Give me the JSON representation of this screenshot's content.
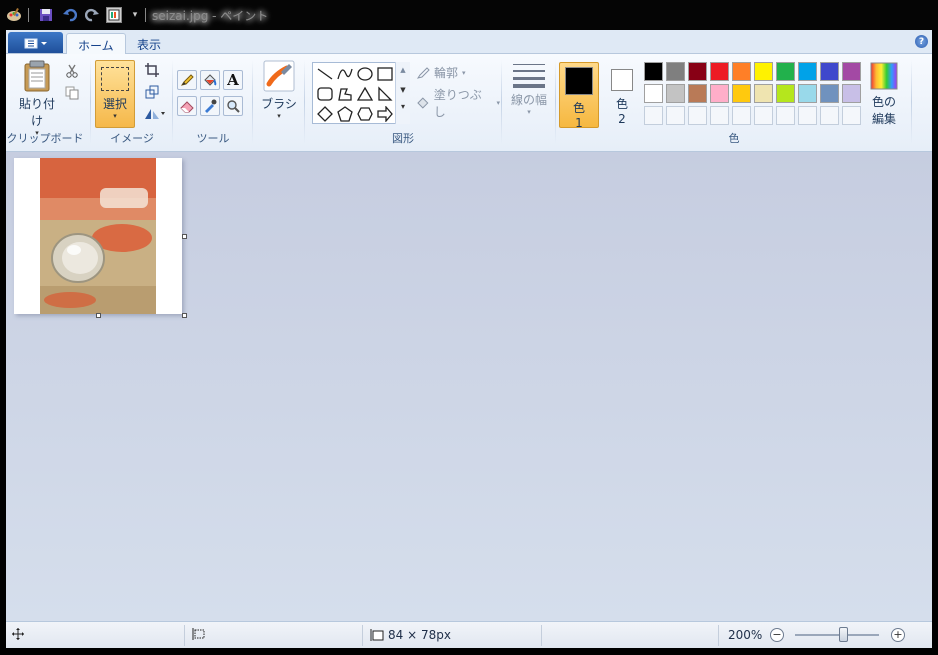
{
  "window": {
    "title": "seizai.jpg - ペイント",
    "quick_access": [
      "paint-app-icon",
      "save-icon",
      "undo-icon",
      "redo-icon",
      "properties-icon",
      "customize-dropdown-icon"
    ]
  },
  "ribbon": {
    "tabs": [
      {
        "label": "ホーム",
        "active": true
      },
      {
        "label": "表示",
        "active": false
      }
    ],
    "groups": {
      "clipboard": {
        "label": "クリップボード",
        "paste_label": "貼り付け"
      },
      "image": {
        "label": "イメージ",
        "select_label": "選択"
      },
      "tools": {
        "label": "ツール"
      },
      "brush": {
        "label": "ブラシ"
      },
      "shapes": {
        "label": "図形",
        "outline_label": "輪郭",
        "fill_label": "塗りつぶし"
      },
      "size": {
        "label": "線の幅"
      },
      "colors": {
        "label": "色",
        "color1_label": "色",
        "color1_num": "1",
        "color2_label": "色",
        "color2_num": "2",
        "color1_value": "#000000",
        "color2_value": "#ffffff",
        "edit_colors_label1": "色の",
        "edit_colors_label2": "編集",
        "palette_row1": [
          "#000000",
          "#7f7f7f",
          "#880015",
          "#ed1c24",
          "#ff7f27",
          "#fff200",
          "#22b14c",
          "#00a2e8",
          "#3f48cc",
          "#a349a4"
        ],
        "palette_row2": [
          "#ffffff",
          "#c3c3c3",
          "#b97a57",
          "#ffaec9",
          "#ffc90e",
          "#efe4b0",
          "#b5e61d",
          "#99d9ea",
          "#7092be",
          "#c8bfe7"
        ]
      }
    }
  },
  "status": {
    "image_size": "84 × 78px",
    "zoom": "200%"
  }
}
